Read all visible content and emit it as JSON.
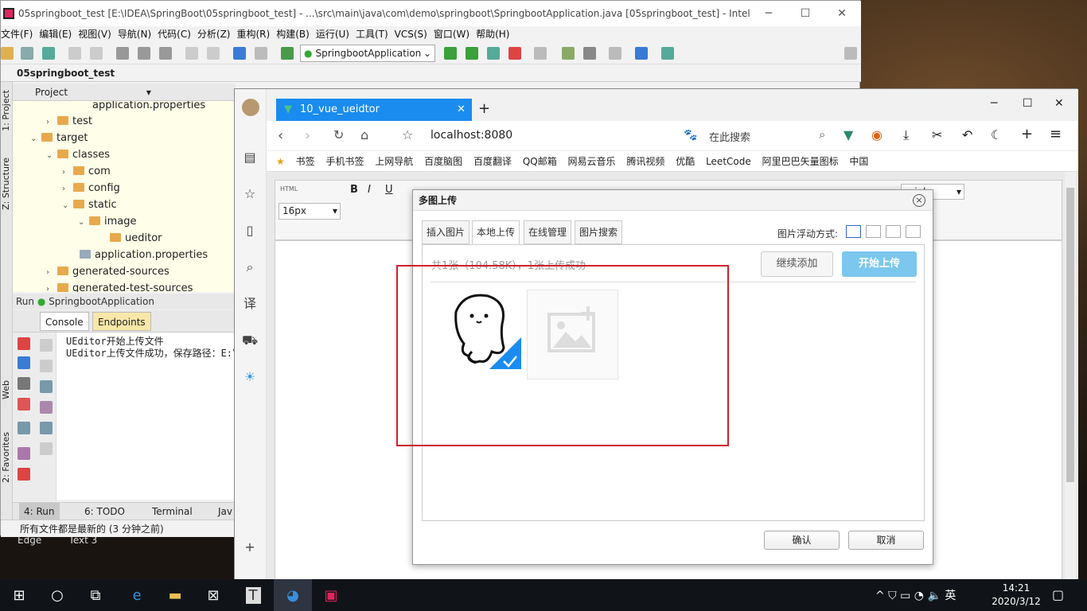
{
  "ide": {
    "title": "05springboot_test [E:\\IDEA\\SpringBoot\\05springboot_test] - ...\\src\\main\\java\\com\\demo\\springboot\\SpringbootApplication.java [05springboot_test] - Intelli...",
    "menu": [
      "文件(F)",
      "编辑(E)",
      "视图(V)",
      "导航(N)",
      "代码(C)",
      "分析(Z)",
      "重构(R)",
      "构建(B)",
      "运行(U)",
      "工具(T)",
      "VCS(S)",
      "窗口(W)",
      "帮助(H)"
    ],
    "run_config": "SpringbootApplication",
    "breadcrumb": "05springboot_test",
    "side_tabs": [
      "1: Project",
      "Z: Structure",
      "Web",
      "2: Favorites"
    ],
    "project_header": "Project",
    "tree": [
      "application.properties",
      "test",
      "target",
      "classes",
      "com",
      "config",
      "static",
      "image",
      "ueditor",
      "application.properties",
      "generated-sources",
      "generated-test-sources"
    ],
    "run_label": "Run",
    "run_app": "SpringbootApplication",
    "run_tabs": [
      "Console",
      "Endpoints"
    ],
    "console_lines": [
      "UEditor开始上传文件",
      "UEditor上传文件成功，保存路径：E:\\"
    ],
    "bottom_tabs": [
      "4: Run",
      "6: TODO",
      "Terminal",
      "Jav"
    ],
    "status": "所有文件都是最新的 (3 分钟之前)"
  },
  "desktop_labels": [
    "Edge",
    "Text 3"
  ],
  "browser": {
    "tab_title": "10_vue_ueidtor",
    "url": "localhost:8080",
    "search_placeholder": "在此搜索",
    "bookmarks": [
      "书签",
      "手机书签",
      "上网导航",
      "百度脑图",
      "百度翻译",
      "QQ邮箱",
      "网易云音乐",
      "腾讯视频",
      "优酷",
      "LeetCode",
      "阿里巴巴矢量图标",
      "中国"
    ],
    "editor_font_size": "16px",
    "editor_font": "arial",
    "editor_html": "HTML"
  },
  "dialog": {
    "title": "多图上传",
    "close": "×",
    "tabs": [
      "插入图片",
      "本地上传",
      "在线管理",
      "图片搜索"
    ],
    "float_label": "图片浮动方式:",
    "status_text": "共1张（104.58K），1张上传成功",
    "add_button": "继续添加",
    "start_button": "开始上传",
    "ok_button": "确认",
    "cancel_button": "取消"
  },
  "taskbar": {
    "time": "14:21",
    "date": "2020/3/12",
    "ime": "英"
  }
}
